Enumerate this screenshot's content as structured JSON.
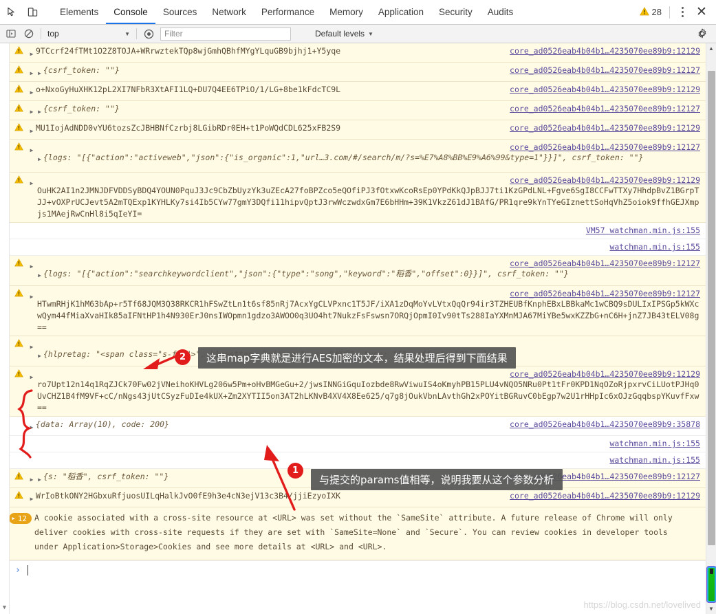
{
  "window": {
    "tabs": [
      {
        "label": "Elements",
        "active": false
      },
      {
        "label": "Console",
        "active": true
      },
      {
        "label": "Sources",
        "active": false
      },
      {
        "label": "Network",
        "active": false
      },
      {
        "label": "Performance",
        "active": false
      },
      {
        "label": "Memory",
        "active": false
      },
      {
        "label": "Application",
        "active": false
      },
      {
        "label": "Security",
        "active": false
      },
      {
        "label": "Audits",
        "active": false
      }
    ],
    "warning_count": "28",
    "close_label": "✕"
  },
  "toolbar": {
    "context_value": "top",
    "context_caret": "▼",
    "filter_placeholder": "Filter",
    "filter_value": "",
    "levels_label": "Default levels",
    "levels_caret": "▼"
  },
  "messages": [
    {
      "id": "m1",
      "type": "warning",
      "arrows": 1,
      "text": "9TCcrf24fTMt1O2Z8TOJA+WRrwztekTQp8wjGmhQBhfMYgYLquGB9bjhj1+Y5yqe",
      "source": "core_ad0526eab4b04b1…4235070ee89b9:12129"
    },
    {
      "id": "m2",
      "type": "warning",
      "arrows": 2,
      "italic": true,
      "text": "{csrf_token: \"\"}",
      "source": "core_ad0526eab4b04b1…4235070ee89b9:12127"
    },
    {
      "id": "m3",
      "type": "warning",
      "arrows": 1,
      "text": "o+NxoGyHuXHK12pL2XI7NFbR3XtAFI1LQ+DU7Q4EE6TPiO/1/LG+8be1kFdcTC9L",
      "source": "core_ad0526eab4b04b1…4235070ee89b9:12129"
    },
    {
      "id": "m4",
      "type": "warning",
      "arrows": 2,
      "italic": true,
      "text": "{csrf_token: \"\"}",
      "source": "core_ad0526eab4b04b1…4235070ee89b9:12127"
    },
    {
      "id": "m5",
      "type": "warning",
      "arrows": 1,
      "text": "MU1IojAdNDD0vYU6tozsZcJBHBNfCzrbj8LGibRDr0EH+t1PoWQdCDL625xFB2S9",
      "source": "core_ad0526eab4b04b1…4235070ee89b9:12129"
    },
    {
      "id": "m6",
      "type": "warning",
      "arrows": 1,
      "italic": true,
      "multiline_obj": true,
      "text": "{logs: \"[{\"action\":\"activeweb\",\"json\":{\"is_organic\":1,\"url…3.com/#/search/m/?s=%E7%A8%BB%E9%A6%99&type=1\"}}]\", csrf_token: \"\"}",
      "source": "core_ad0526eab4b04b1…4235070ee89b9:12127"
    },
    {
      "id": "m7",
      "type": "warning",
      "arrows": 1,
      "blockbody": true,
      "text": "OuHK2AI1n2JMNJDFVDDSyBDQ4YOUN0PquJ3Jc9CbZbUyzYk3uZEcA27foBPZco5eQOfiPJ3fOtxwKcoRsEp0YPdKkQJpBJJ7ti1KzGPdLNL+Fgve6SgI8CCFwTTXy7HhdpBvZ1BGrpTJJ+vOXPrUCJevt5A2mTQExp1KYHLKy7si4Ib5CYw77gmY3DQfi11hipvQptJ3rwWczwdxGm7E6bHHm+39K1VkzZ61dJ1BAfG/PR1qre9kYnTYeGIznettSoHqVhZ5oiok9ffhGEJXmpjs1MAejRwCnHl8i5qIeYI=",
      "source": "core_ad0526eab4b04b1…4235070ee89b9:12129"
    },
    {
      "id": "m8",
      "type": "plain",
      "arrows": 0,
      "text": "",
      "source": "VM57 watchman.min.js:155"
    },
    {
      "id": "m9",
      "type": "plain",
      "arrows": 0,
      "text": "",
      "source": "watchman.min.js:155"
    },
    {
      "id": "m10",
      "type": "warning",
      "arrows": 1,
      "italic": true,
      "inline_obj": true,
      "text": "{logs: \"[{\"action\":\"searchkeywordclient\",\"json\":{\"type\":\"song\",\"keyword\":\"稻香\",\"offset\":0}}]\", csrf_token: \"\"}",
      "source": "core_ad0526eab4b04b1…4235070ee89b9:12127"
    },
    {
      "id": "m11",
      "type": "warning",
      "arrows": 1,
      "blockbody": true,
      "text": "HTwmRHjK1hM63bAp+r5Tf68JQM3Q38RKCR1hFSwZtLn1t6sf85nRj7AcxYgCLVPxnc1T5JF/iXA1zDqMoYvLVtxQqQr94ir3TZHEUBfKnphEBxLBBkaMc1wCBQ9sDULIxIPSGp5kWXcwQym44fMiaXvaHIk85aIFNtHP1h4N930ErJ0nsIWOpmn1gdzo3AWOO0q3UO4ht7NukzFsFswsn7ORQjOpmI0Iv90tTs288IaYXMnMJA67MiYBe5wxKZZbG+nC6H+jnZ7JB43tELV08g==",
      "source": "core_ad0526eab4b04b1…4235070ee89b9:12127"
    },
    {
      "id": "m12",
      "type": "warning",
      "arrows": 1,
      "italic": true,
      "text": "{hlpretag: \"<span class=\"s-fc7\">\", hlposttag: \"</span>\", s: \"稻香\", type: \"1\", offset: \"0\", …}",
      "source": ""
    },
    {
      "id": "m13",
      "type": "warning",
      "arrows": 1,
      "blockbody": true,
      "text": "ro7Upt12n14q1RqZJCk70Fw02jVNeihoKHVLg206w5Pm+oHvBMGeGu+2/jwsINNGiGquIozbde8RwViwuIS4oKmyhPB15PLU4vNQO5NRu0Pt1tFr0KPD1NqOZoRjpxrvCiLUotPJHq0UvCHZ1B4fM9VF+cC/nNgs43jUtCSyzFuDIe4kUX+Zm2XYTII5on3AT2hLKNvB4XV4X8Ee625/q7g8jOukVbnLAvthGh2xPOYitBGRuvC0bEgp7w2U1rHHpIc6xOJzGqqbspYKuvfFxw==",
      "source": "core_ad0526eab4b04b1…4235070ee89b9:12129"
    },
    {
      "id": "m14",
      "type": "plain",
      "arrows": 1,
      "italic": true,
      "text": "{data: Array(10), code: 200}",
      "source": "core_ad0526eab4b04b1…4235070ee89b9:35878"
    },
    {
      "id": "m15",
      "type": "plain",
      "arrows": 0,
      "text": "",
      "source": "watchman.min.js:155"
    },
    {
      "id": "m16",
      "type": "plain",
      "arrows": 0,
      "text": "",
      "source": "watchman.min.js:155"
    },
    {
      "id": "m17",
      "type": "warning",
      "arrows": 2,
      "italic": true,
      "text": "{s: \"稻香\", csrf_token: \"\"}",
      "source": "core_ad0526eab4b04b1…4235070ee89b9:12127"
    },
    {
      "id": "m18",
      "type": "warning",
      "arrows": 1,
      "text": "WrIoBtkONY2HGbxuRfjuosUILqHalkJvO0fE9h3e4cN3ejV13c3B4/jjiEzyoIXK",
      "source": "core_ad0526eab4b04b1…4235070ee89b9:12129"
    }
  ],
  "violation": {
    "badge_count": "12",
    "badge_icon": "▶",
    "text": "A cookie associated with a cross-site resource at <URL> was set without the `SameSite` attribute. A future release of Chrome will only deliver cookies with cross-site requests if they are set with `SameSite=None` and `Secure`. You can review cookies in developer tools under Application>Storage>Cookies and see more details at <URL> and <URL>."
  },
  "prompt": {
    "caret": "›",
    "value": ""
  },
  "annotations": [
    {
      "id": "anno2",
      "number": "2",
      "text": "这串map字典就是进行AES加密的文本，结果处理后得到下面结果"
    },
    {
      "id": "anno1",
      "number": "1",
      "text": "与提交的params值相等，说明我要从这个参数分析"
    }
  ],
  "watermark": "https://blog.csdn.net/lovelived",
  "colors": {
    "accent": "#1a73e8",
    "warning_bg": "#fffbe5",
    "warning_icon": "#f0b400",
    "annotation_red": "#e21b1b",
    "link": "#5a4a9c"
  }
}
